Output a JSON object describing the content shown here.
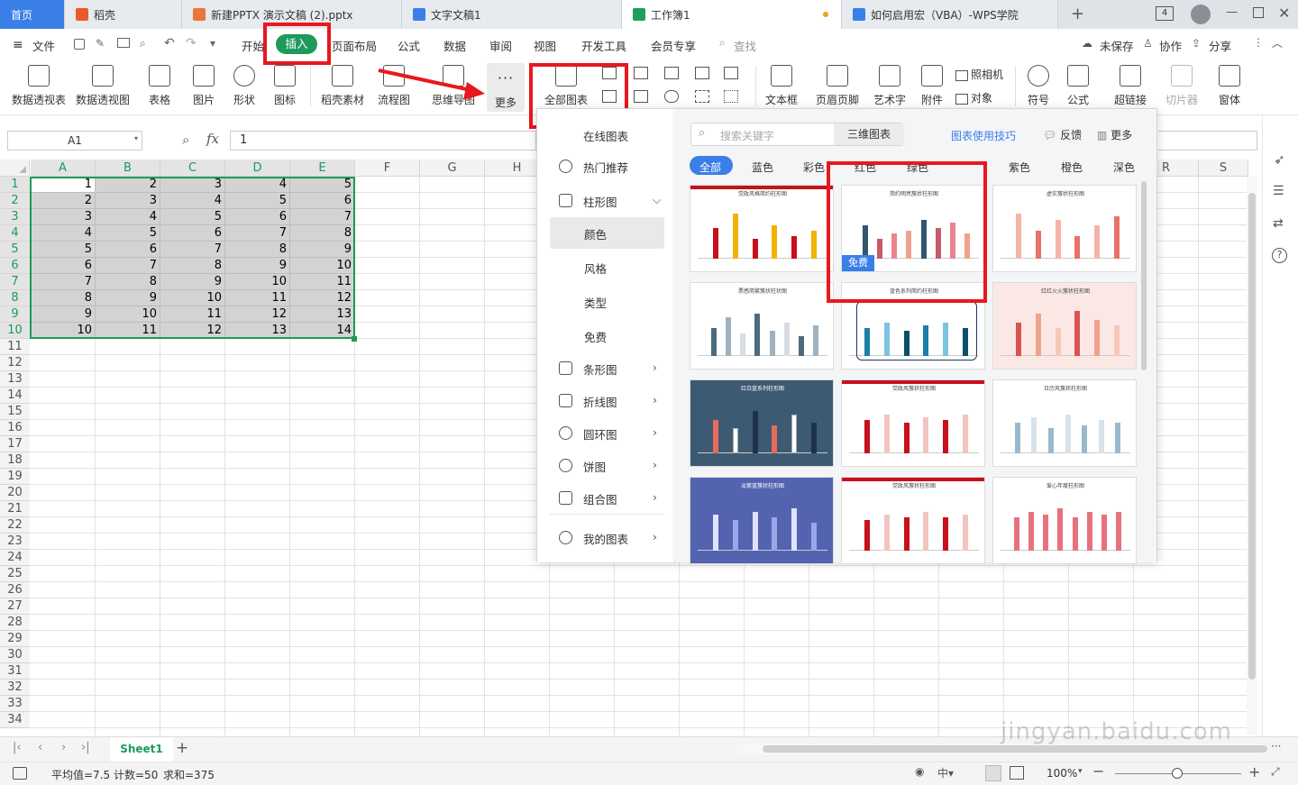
{
  "tabs": [
    {
      "label": "首页",
      "kind": "home"
    },
    {
      "label": "稻壳",
      "kind": "docer",
      "color": "#ea5b2a"
    },
    {
      "label": "新建PPTX 演示文稿 (2).pptx",
      "kind": "ppt",
      "color": "#e9763b"
    },
    {
      "label": "文字文稿1",
      "kind": "doc",
      "color": "#3a7ee8"
    },
    {
      "label": "工作簿1",
      "kind": "xls",
      "color": "#1e9e5f",
      "active": true
    },
    {
      "label": "如何启用宏（VBA）-WPS学院",
      "kind": "web",
      "color": "#3a7ee8"
    }
  ],
  "tab_badge": "4",
  "menu": {
    "file": "文件",
    "items": [
      "开始",
      "插入",
      "页面布局",
      "公式",
      "数据",
      "审阅",
      "视图",
      "开发工具",
      "会员专享"
    ],
    "search": "查找",
    "unsaved": "未保存",
    "collab": "协作",
    "share": "分享"
  },
  "ribbon": {
    "buttons": [
      "数据透视表",
      "数据透视图",
      "表格",
      "图片",
      "形状",
      "图标",
      "稻壳素材",
      "流程图",
      "思维导图",
      "更多",
      "全部图表"
    ],
    "right_buttons": [
      "文本框",
      "页眉页脚",
      "艺术字",
      "附件",
      "符号",
      "公式",
      "超链接",
      "切片器",
      "窗体"
    ],
    "camera": "照相机",
    "object": "对象"
  },
  "formula_bar": {
    "name_box": "A1",
    "fx": "fx",
    "value": "1"
  },
  "sheet": {
    "columns": [
      "A",
      "B",
      "C",
      "D",
      "E",
      "F",
      "G",
      "H",
      "R",
      "S"
    ],
    "rows": [
      "1",
      "2",
      "3",
      "4",
      "5",
      "6",
      "7",
      "8",
      "9",
      "10",
      "11",
      "12",
      "13",
      "14",
      "15",
      "16",
      "17",
      "18",
      "19",
      "20",
      "21",
      "22",
      "23",
      "24",
      "25",
      "26",
      "27",
      "28",
      "29",
      "30",
      "31",
      "32",
      "33",
      "34"
    ],
    "data": [
      [
        1,
        2,
        3,
        4,
        5
      ],
      [
        2,
        3,
        4,
        5,
        6
      ],
      [
        3,
        4,
        5,
        6,
        7
      ],
      [
        4,
        5,
        6,
        7,
        8
      ],
      [
        5,
        6,
        7,
        8,
        9
      ],
      [
        6,
        7,
        8,
        9,
        10
      ],
      [
        7,
        8,
        9,
        10,
        11
      ],
      [
        8,
        9,
        10,
        11,
        12
      ],
      [
        9,
        10,
        11,
        12,
        13
      ],
      [
        10,
        11,
        12,
        13,
        14
      ]
    ]
  },
  "chart_panel": {
    "search_placeholder": "搜索关键字",
    "three_d": "三维图表",
    "tips": "图表使用技巧",
    "feedback": "反馈",
    "more": "更多",
    "nav": {
      "online": "在线图表",
      "hot": "热门推荐",
      "column": "柱形图",
      "column_sub": [
        "颜色",
        "风格",
        "类型",
        "免费"
      ],
      "others": [
        "条形图",
        "折线图",
        "圆环图",
        "饼图",
        "组合图"
      ],
      "mine": "我的图表"
    },
    "color_filters": [
      "全部",
      "蓝色",
      "彩色",
      "红色",
      "绿色",
      "紫色",
      "橙色",
      "深色"
    ],
    "free_badge": "免费",
    "thumb_titles": [
      "党政风格简约柱形图",
      "简约明亮簇状柱形图",
      "虚实簇状柱形图",
      "票感简繁簇状柱状图",
      "蓝色系列简约柱形图",
      "红红火火簇状柱形图",
      "红白蓝系列柱形图",
      "党政风簇状柱形图",
      "日历风簇状柱形图",
      "淡紫蓝簇状柱形图",
      "党政风簇状柱形图",
      "爱心年度柱形图"
    ]
  },
  "sheet_tabs": {
    "active": "Sheet1",
    "add": "+"
  },
  "status": {
    "average": "平均值=7.5",
    "count": "计数=50",
    "sum": "求和=375",
    "zoom": "100%"
  },
  "watermark": "jingyan.baidu.com",
  "accent": "#1d9a5c",
  "highlight": "#e8181e"
}
